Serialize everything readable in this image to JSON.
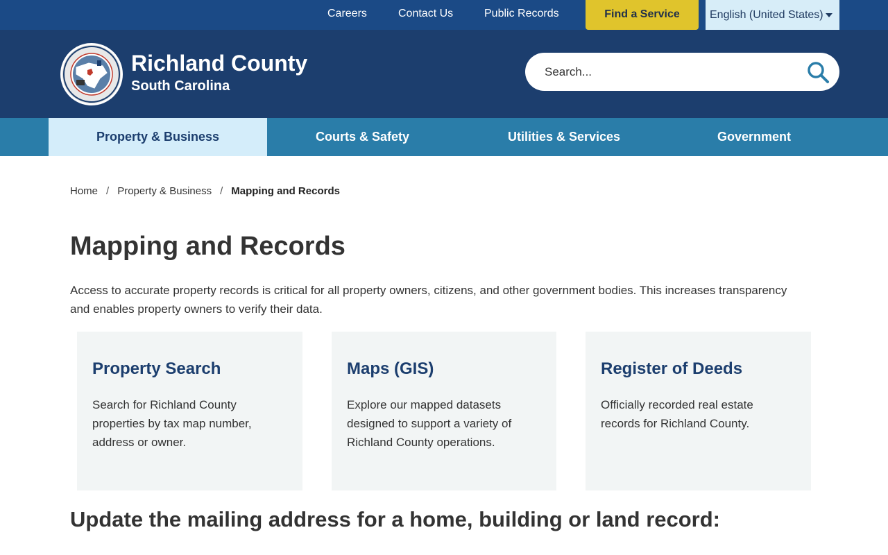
{
  "utility_nav": {
    "careers": "Careers",
    "contact_us": "Contact Us",
    "public_records": "Public Records",
    "find_service": "Find a Service",
    "language": "English (United States)"
  },
  "header": {
    "title": "Richland County",
    "subtitle": "South Carolina",
    "search_placeholder": "Search..."
  },
  "main_nav": {
    "items": [
      {
        "label": "Property & Business",
        "active": true
      },
      {
        "label": "Courts & Safety",
        "active": false
      },
      {
        "label": "Utilities & Services",
        "active": false
      },
      {
        "label": "Government",
        "active": false
      }
    ]
  },
  "breadcrumb": {
    "home": "Home",
    "parent": "Property & Business",
    "current": "Mapping and Records"
  },
  "page": {
    "title": "Mapping and Records",
    "intro": "Access to accurate property records is critical for all property owners, citizens, and other government bodies. This increases transparency and enables property owners to verify their data.",
    "cards": [
      {
        "title": "Property Search",
        "description": "Search for Richland County properties by tax map number, address or owner."
      },
      {
        "title": "Maps (GIS)",
        "description": "Explore our mapped datasets designed to support a variety of Richland County operations."
      },
      {
        "title": "Register of Deeds",
        "description": "Officially recorded real estate records for Richland County."
      }
    ],
    "section_heading": "Update the mailing address for a home, building or land record:"
  },
  "colors": {
    "utility_bar": "#1b4a86",
    "header": "#1c3e6e",
    "nav": "#2a7da9",
    "nav_active": "#d4edfa",
    "find_service": "#e0c42c",
    "card_bg": "#f2f5f5",
    "card_title": "#1c3e6e"
  },
  "icons": {
    "search": "search-icon",
    "language_caret": "caret-down-icon",
    "seal": "county-seal-logo"
  }
}
